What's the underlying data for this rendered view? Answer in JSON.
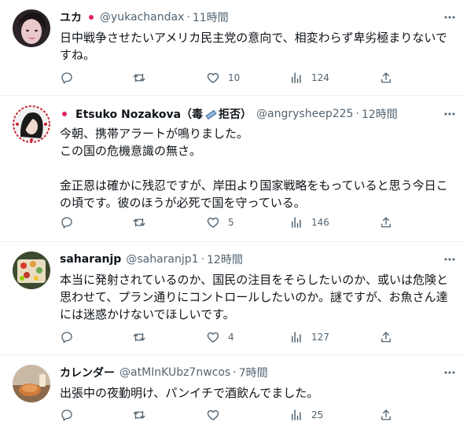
{
  "tweets": [
    {
      "name": "ユカ",
      "handle": "@yukachandax",
      "dot": "·",
      "time": "11時間",
      "text": "日中戦争させたいアメリカ民主党の意向で、相変わらず卑劣極まりないですね。",
      "replies": "",
      "retweets": "",
      "likes": "10",
      "views": "124"
    },
    {
      "name": "Etsuko Nozakova（毒",
      "name_tail": "拒否）",
      "handle": "@angrysheep225",
      "dot": "·",
      "time": "12時間",
      "text": "今朝、携帯アラートが鳴りました。\nこの国の危機意識の無さ。\n\n金正恩は確かに残忍ですが、岸田より国家戦略をもっていると思う今日この頃です。彼のほうが必死で国を守っている。",
      "replies": "",
      "retweets": "",
      "likes": "5",
      "views": "146"
    },
    {
      "name": "saharanjp",
      "handle": "@saharanjp1",
      "dot": "·",
      "time": "12時間",
      "text": "本当に発射されているのか、国民の注目をそらしたいのか、或いは危険と思わせて、プラン通りにコントロールしたいのか。謎ですが、お魚さん達には迷惑かけないでほしいです。",
      "replies": "",
      "retweets": "",
      "likes": "4",
      "views": "127"
    },
    {
      "name": "カレンダー",
      "handle": "@atMInKUbz7nwcos",
      "dot": "·",
      "time": "7時間",
      "text": "出張中の夜勤明け、パンイチで酒飲んでました。",
      "replies": "",
      "retweets": "",
      "likes": "",
      "views": "25"
    }
  ],
  "icons": {
    "more": "more-dots-icon",
    "reply": "reply-icon",
    "retweet": "retweet-icon",
    "like": "heart-icon",
    "views": "views-icon",
    "share": "share-icon"
  },
  "colors": {
    "text": "#0f1419",
    "muted": "#536471",
    "divider": "#eff3f4",
    "flag_red": "#e0245e"
  }
}
